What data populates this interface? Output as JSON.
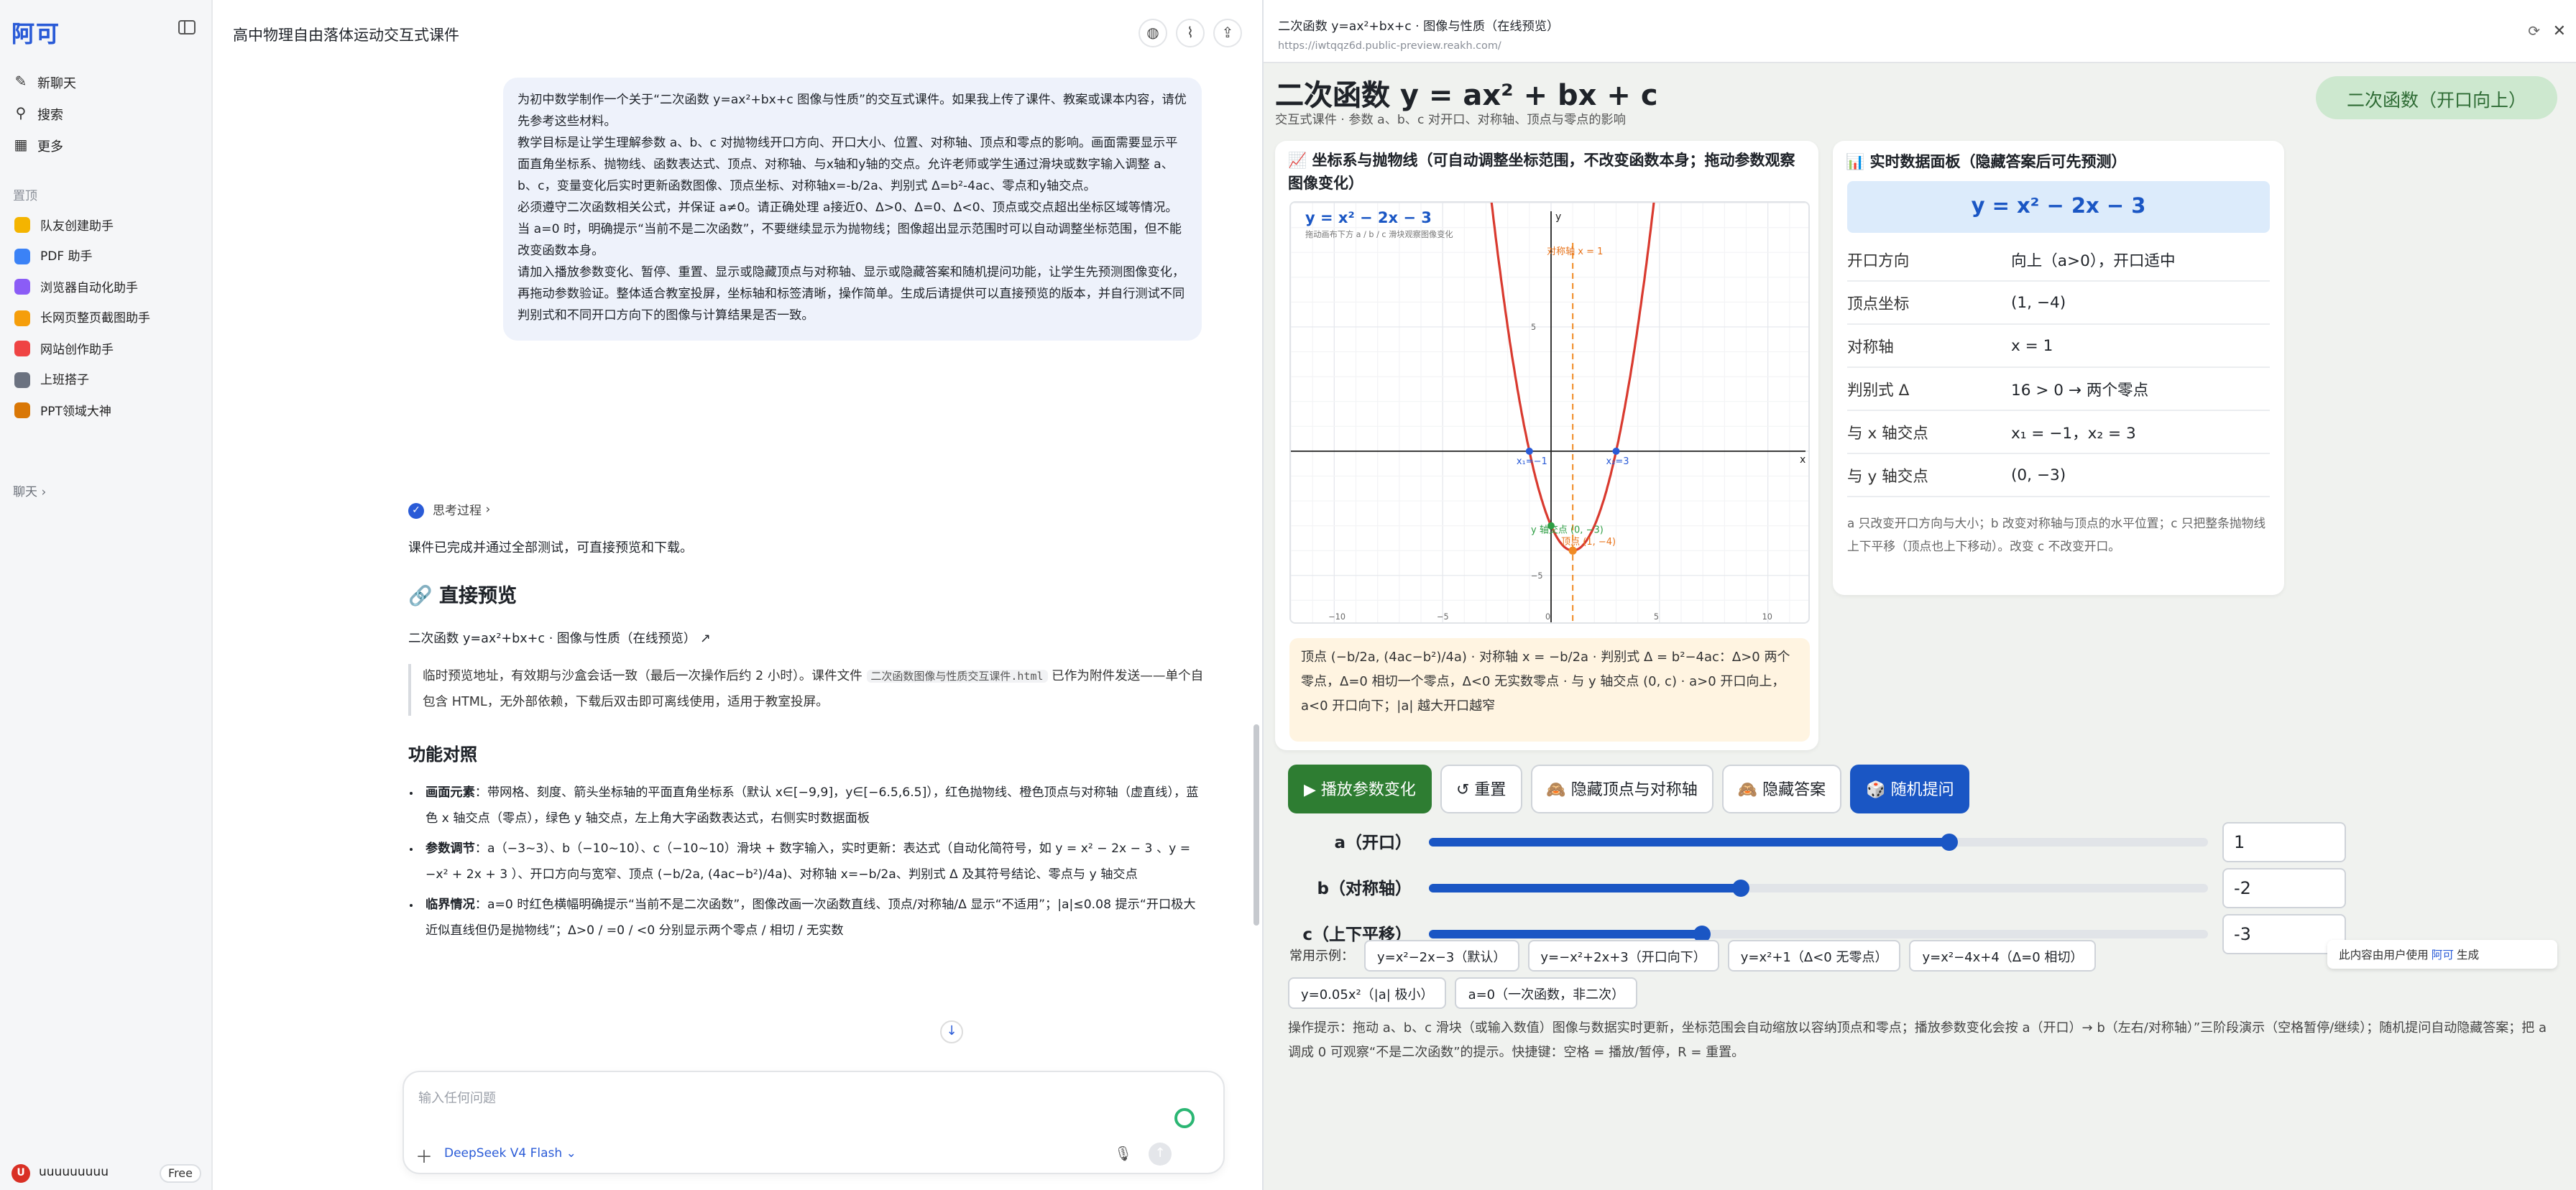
{
  "sidebar": {
    "logo": "阿可",
    "nav": [
      {
        "label": "新聊天",
        "icon": "edit-icon"
      },
      {
        "label": "搜索",
        "icon": "search-icon"
      },
      {
        "label": "更多",
        "icon": "grid-icon"
      }
    ],
    "pinned_label": "置顶",
    "pinned": [
      {
        "label": "队友创建助手",
        "color": "#f4b400"
      },
      {
        "label": "PDF 助手",
        "color": "#3b82f6"
      },
      {
        "label": "浏览器自动化助手",
        "color": "#8b5cf6"
      },
      {
        "label": "长网页整页截图助手",
        "color": "#f59e0b"
      },
      {
        "label": "网站创作助手",
        "color": "#ef4444"
      },
      {
        "label": "上班搭子",
        "color": "#6b7280"
      },
      {
        "label": "PPT领域大神",
        "color": "#d97706"
      }
    ],
    "chats_label": "聊天",
    "user": {
      "initial": "U",
      "name": "uuuuuuuuu",
      "plan": "Free"
    }
  },
  "chat": {
    "title": "高中物理自由落体运动交互式课件",
    "user_message": [
      "为初中数学制作一个关于“二次函数 y=ax²+bx+c 图像与性质”的交互式课件。如果我上传了课件、教案或课本内容，请优先参考这些材料。",
      "教学目标是让学生理解参数 a、b、c 对抛物线开口方向、开口大小、位置、对称轴、顶点和零点的影响。画面需要显示平面直角坐标系、抛物线、函数表达式、顶点、对称轴、与x轴和y轴的交点。允许老师或学生通过滑块或数字输入调整 a、b、c，变量变化后实时更新函数图像、顶点坐标、对称轴x=-b/2a、判别式 Δ=b²-4ac、零点和y轴交点。",
      "必须遵守二次函数相关公式，并保证 a≠0。请正确处理 a接近0、Δ>0、Δ=0、Δ<0、顶点或交点超出坐标区域等情况。当 a=0 时，明确提示“当前不是二次函数”，不要继续显示为抛物线；图像超出显示范围时可以自动调整坐标范围，但不能改变函数本身。",
      "请加入播放参数变化、暂停、重置、显示或隐藏顶点与对称轴、显示或隐藏答案和随机提问功能，让学生先预测图像变化，再拖动参数验证。整体适合教室投屏，坐标轴和标签清晰，操作简单。生成后请提供可以直接预览的版本，并自行测试不同判别式和不同开口方向下的图像与计算结果是否一致。"
    ],
    "thinking_label": "思考过程",
    "done_text": "课件已完成并通过全部测试，可直接预览和下载。",
    "preview_heading": "🔗 直接预览",
    "preview_link": "二次函数 y=ax²+bx+c · 图像与性质（在线预览）",
    "quote_parts": [
      "临时预览地址，有效期与沙盒会话一致（最后一次操作后约 2 小时）。课件文件 ",
      "二次函数图像与性质交互课件.html",
      " 已作为附件发送——单个自包含 HTML，无外部依赖，下载后双击即可离线使用，适用于教室投屏。"
    ],
    "feature_heading": "功能对照",
    "features": [
      {
        "title": "画面元素",
        "text": "：带网格、刻度、箭头坐标轴的平面直角坐标系（默认 x∈[−9,9]，y∈[−6.5,6.5]），红色抛物线、橙色顶点与对称轴（虚直线），蓝色 x 轴交点（零点），绿色 y 轴交点，左上角大字函数表达式，右侧实时数据面板"
      },
      {
        "title": "参数调节",
        "text": "：a（−3~3）、b（−10~10）、c（−10~10）滑块 + 数字输入，实时更新：表达式（自动化简符号，如 y = x² − 2x − 3 、y = −x² + 2x + 3 ）、开口方向与宽窄、顶点 (−b/2a, (4ac−b²)/4a)、对称轴 x=−b/2a、判别式 Δ 及其符号结论、零点与 y 轴交点"
      },
      {
        "title": "临界情况",
        "text": "：a=0 时红色横幅明确提示“当前不是二次函数”，图像改画一次函数直线、顶点/对称轴/Δ 显示“不适用”；|a|≤0.08 提示“开口极大近似直线但仍是抛物线”；Δ>0 / =0 / <0 分别显示两个零点 / 相切 / 无实数"
      }
    ],
    "input_placeholder": "输入任何问题",
    "model": "DeepSeek V4 Flash"
  },
  "preview": {
    "window_title": "二次函数 y=ax²+bx+c · 图像与性质（在线预览）",
    "url": "https://iwtqqz6d.public-preview.reakh.com/",
    "hero_title": "二次函数 y = ax² + bx + c",
    "hero_sub": "交互式课件 · 参数 a、b、c 对开口、对称轴、顶点与零点的影响",
    "hero_badge": "二次函数（开口向上）",
    "plot_title": "📈 坐标系与抛物线（可自动调整坐标范围，不改变函数本身；拖动参数观察图像变化）",
    "plot_expr": "y = x² − 2x − 3",
    "plot_hint": "拖动画布下方 a / b / c 滑块观察图像变化",
    "plot_axis_label": "对称轴 x = 1",
    "plot_root1": "x₁=−1",
    "plot_root2": "x₂=3",
    "plot_vertex": "顶点 (1, −4)",
    "plot_yint": "y 轴交点 (0, −3)",
    "formula_note": "顶点 (−b/2a, (4ac−b²)/4a)  ·  对称轴 x = −b/2a  ·  判别式 Δ = b²−4ac：Δ>0 两个零点，Δ=0 相切一个零点，Δ<0 无实数零点  ·  与 y 轴交点 (0, c)  ·  a>0 开口向上，a<0 开口向下；|a| 越大开口越窄",
    "panel_title": "📊 实时数据面板（隐藏答案后可先预测）",
    "panel_eq": "y = x² − 2x − 3",
    "props": [
      {
        "k": "开口方向",
        "v": "向上（a>0），开口适中"
      },
      {
        "k": "顶点坐标",
        "v": "(1, −4)"
      },
      {
        "k": "对称轴",
        "v": "x = 1"
      },
      {
        "k": "判别式 Δ",
        "v": "16 > 0 → 两个零点"
      },
      {
        "k": "与 x 轴交点",
        "v": "x₁ = −1，x₂ = 3"
      },
      {
        "k": "与 y 轴交点",
        "v": "(0, −3)"
      }
    ],
    "panel_note": "a 只改变开口方向与大小；b 改变对称轴与顶点的水平位置；c 只把整条抛物线上下平移（顶点也上下移动）。改变 c 不改变开口。",
    "buttons": [
      {
        "label": "▶ 播放参数变化",
        "kind": "play"
      },
      {
        "label": "↺ 重置",
        "kind": "plain"
      },
      {
        "label": "🙈 隐藏顶点与对称轴",
        "kind": "plain"
      },
      {
        "label": "🙈 隐藏答案",
        "kind": "plain"
      },
      {
        "label": "🎲 随机提问",
        "kind": "rand"
      }
    ],
    "sliders": [
      {
        "label": "a（开口）",
        "value": "1",
        "fraction": 0.667
      },
      {
        "label": "b（对称轴）",
        "value": "-2",
        "fraction": 0.4
      },
      {
        "label": "c（上下平移）",
        "value": "-3",
        "fraction": 0.35
      }
    ],
    "examples_label": "常用示例：",
    "examples_row1": [
      "y=x²−2x−3（默认）",
      "y=−x²+2x+3（开口向下）",
      "y=x²+1（Δ<0 无零点）",
      "y=x²−4x+4（Δ=0 相切）"
    ],
    "examples_row2": [
      "y=0.05x²（|a| 极小）",
      "a=0（一次函数，非二次）"
    ],
    "tip": "操作提示：拖动 a、b、c 滑块（或输入数值）图像与数据实时更新，坐标范围会自动缩放以容纳顶点和零点；播放参数变化会按 a（开口）→ b（左右/对称轴）”三阶段演示（空格暂停/继续）；随机提问自动隐藏答案；把 a 调成 0 可观察“不是二次函数”的提示。快捷键：空格 = 播放/暂停，R = 重置。",
    "ai_badge": [
      "此内容由用户使用",
      "阿可",
      "生成"
    ]
  },
  "colors": {
    "accent": "#1a56c4",
    "parabola": "#d93a2f",
    "axis_line": "#f08a24",
    "roots": "#2a5bd7",
    "yint": "#2e9e44"
  }
}
